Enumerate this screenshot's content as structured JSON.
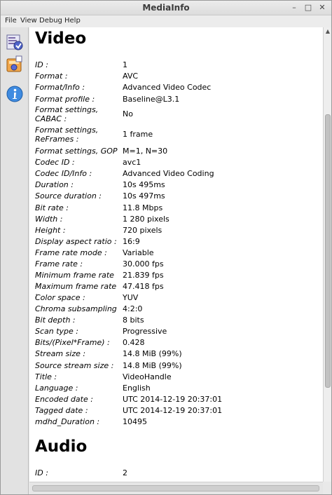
{
  "window": {
    "title": "MediaInfo"
  },
  "titlebar_buttons": {
    "minimize": "–",
    "maximize": "□",
    "close": "✕"
  },
  "menu": [
    "File",
    "View",
    "Debug",
    "Help"
  ],
  "sidebar_icons": [
    "basic-view-icon",
    "sheet-view-icon",
    "info-icon"
  ],
  "sections": [
    {
      "title": "Video",
      "rows": [
        {
          "label": "ID :",
          "value": "1"
        },
        {
          "label": "Format :",
          "value": "AVC"
        },
        {
          "label": "Format/Info :",
          "value": "Advanced Video Codec"
        },
        {
          "label": "Format profile :",
          "value": "Baseline@L3.1"
        },
        {
          "label": "Format settings, CABAC :",
          "value": "No"
        },
        {
          "label": "Format settings, ReFrames :",
          "value": "1 frame"
        },
        {
          "label": "Format settings, GOP :",
          "value": "M=1, N=30"
        },
        {
          "label": "Codec ID :",
          "value": "avc1"
        },
        {
          "label": "Codec ID/Info :",
          "value": "Advanced Video Coding"
        },
        {
          "label": "Duration :",
          "value": "10s 495ms"
        },
        {
          "label": "Source duration :",
          "value": "10s 497ms"
        },
        {
          "label": "Bit rate :",
          "value": "11.8 Mbps"
        },
        {
          "label": "Width :",
          "value": "1 280 pixels"
        },
        {
          "label": "Height :",
          "value": "720 pixels"
        },
        {
          "label": "Display aspect ratio :",
          "value": "16:9"
        },
        {
          "label": "Frame rate mode :",
          "value": "Variable"
        },
        {
          "label": "Frame rate :",
          "value": "30.000 fps"
        },
        {
          "label": "Minimum frame rate :",
          "value": "21.839 fps"
        },
        {
          "label": "Maximum frame rate :",
          "value": "47.418 fps"
        },
        {
          "label": "Color space :",
          "value": "YUV"
        },
        {
          "label": "Chroma subsampling :",
          "value": "4:2:0"
        },
        {
          "label": "Bit depth :",
          "value": "8 bits"
        },
        {
          "label": "Scan type :",
          "value": "Progressive"
        },
        {
          "label": "Bits/(Pixel*Frame) :",
          "value": "0.428"
        },
        {
          "label": "Stream size :",
          "value": "14.8 MiB (99%)"
        },
        {
          "label": "Source stream size :",
          "value": "14.8 MiB (99%)"
        },
        {
          "label": "Title :",
          "value": "VideoHandle"
        },
        {
          "label": "Language :",
          "value": "English"
        },
        {
          "label": "Encoded date :",
          "value": "UTC 2014-12-19 20:37:01"
        },
        {
          "label": "Tagged date :",
          "value": "UTC 2014-12-19 20:37:01"
        },
        {
          "label": "mdhd_Duration :",
          "value": "10495"
        }
      ]
    },
    {
      "title": "Audio",
      "rows": [
        {
          "label": "ID :",
          "value": "2"
        }
      ]
    }
  ]
}
